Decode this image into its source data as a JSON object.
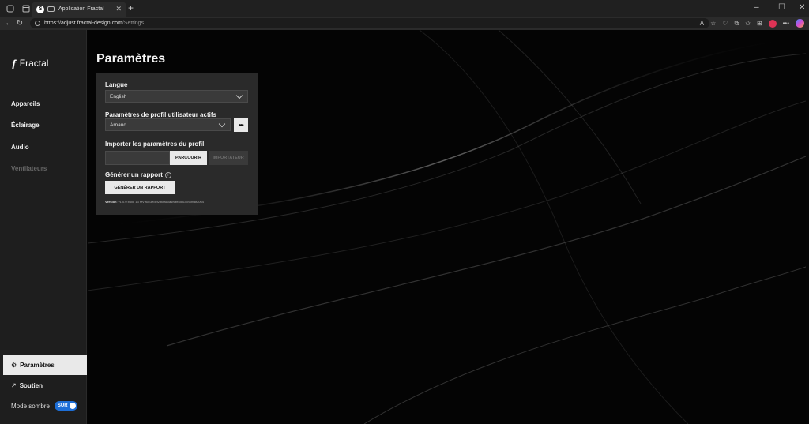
{
  "browser": {
    "tab_title": "Application Fractal",
    "url_host": "https://adjust.fractal-design.com",
    "url_path": "/Settings"
  },
  "sidebar": {
    "logo": "Fractal",
    "items": [
      {
        "label": "Appareils"
      },
      {
        "label": "Éclairage"
      },
      {
        "label": "Audio"
      },
      {
        "label": "Ventilateurs"
      }
    ],
    "active_item": "Paramètres",
    "support_label": "Soutien",
    "dark_mode_label": "Mode sombre",
    "dark_mode_toggle": "SUR"
  },
  "main": {
    "title": "Paramètres",
    "language_label": "Langue",
    "language_value": "English",
    "profile_label": "Paramètres de profil utilisateur actifs",
    "profile_value": "Arnaud",
    "more_label": "•••",
    "import_label": "Importer les paramètres du profil",
    "browse_label": "PARCOURIR",
    "import_button": "IMPORTATEUR",
    "report_label": "Générer un rapport",
    "report_button": "GÉNÉRER UN RAPPORT",
    "version_label": "Version",
    "version_value": ": v1.0.0 build 13 rev a0c3edcf2fb8ac0a1f6bf4dd15c9cfb8f2064"
  },
  "colors": {
    "toggle_on": "#1d6ed6",
    "sidebar_bg": "#1e1e1e",
    "panel_bg": "#2a2a2a"
  }
}
